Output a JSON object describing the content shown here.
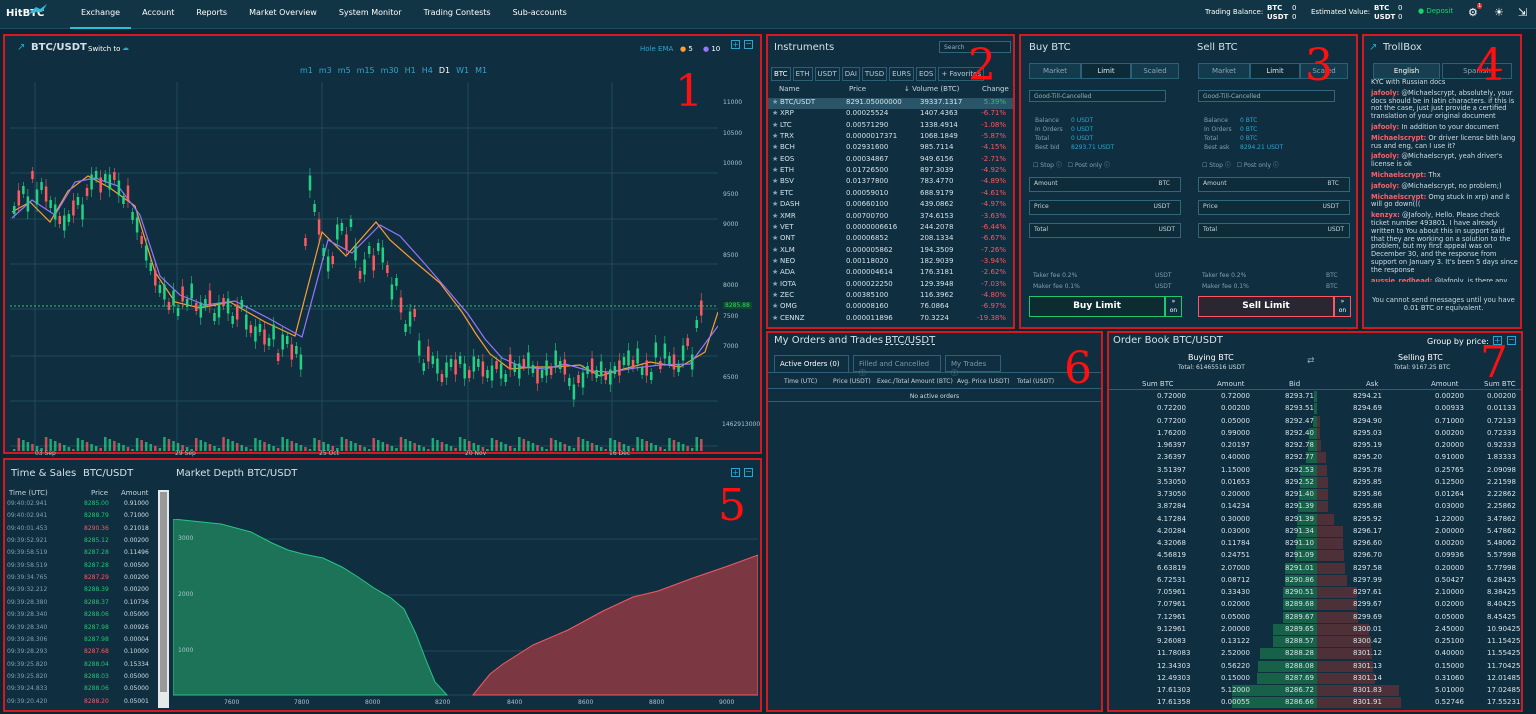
{
  "header": {
    "logo": "HitBTC",
    "nav": [
      "Exchange",
      "Account",
      "Reports",
      "Market Overview",
      "System Monitor",
      "Trading Contests",
      "Sub-accounts"
    ],
    "trading_balance_label": "Trading Balance:",
    "btc_label": "BTC",
    "usdt_label": "USDT",
    "btc_balance": "0",
    "usdt_balance": "0",
    "estimated_label": "Estimated Value:",
    "est_btc": "0",
    "est_usdt": "0",
    "deposit": "Deposit",
    "settings_badge": "1"
  },
  "chart": {
    "title": "BTC/USDT",
    "switch_label": "Switch to",
    "hole_ema": "Hole EMA",
    "ema1": "5",
    "ema2": "10",
    "timeframes": [
      "m1",
      "m3",
      "m5",
      "m15",
      "m30",
      "H1",
      "H4",
      "D1",
      "W1",
      "M1"
    ],
    "price_labels": [
      "11000",
      "10500",
      "10000",
      "9500",
      "9000",
      "8500",
      "8000",
      "7500",
      "7000",
      "6500"
    ],
    "last_price": "8285.88",
    "volume_label": "1462913000",
    "dates": [
      "03 Sep",
      "29 Sep",
      "25 Oct",
      "20 Nov",
      "16 Dec"
    ],
    "number": "1"
  },
  "instruments": {
    "title": "Instruments",
    "search": "Search",
    "tabs": [
      "BTC",
      "ETH",
      "USDT",
      "DAI",
      "TUSD",
      "EURS",
      "EOS",
      "+ Favorites"
    ],
    "headers": [
      "Name",
      "Price",
      "Volume (BTC)",
      "Change"
    ],
    "rows": [
      [
        "BTC/USDT",
        "8291.05000000",
        "39337.1317",
        "5.39%"
      ],
      [
        "XRP",
        "0.00025524",
        "1407.4363",
        "-6.71%"
      ],
      [
        "LTC",
        "0.00571290",
        "1338.4914",
        "-1.08%"
      ],
      [
        "TRX",
        "0.0000017371",
        "1068.1849",
        "-5.87%"
      ],
      [
        "BCH",
        "0.02931600",
        "985.7114",
        "-4.15%"
      ],
      [
        "EOS",
        "0.00034867",
        "949.6156",
        "-2.71%"
      ],
      [
        "ETH",
        "0.01726500",
        "897.3039",
        "-4.92%"
      ],
      [
        "BSV",
        "0.01377800",
        "783.4770",
        "-4.89%"
      ],
      [
        "ETC",
        "0.00059010",
        "688.9179",
        "-4.61%"
      ],
      [
        "DASH",
        "0.00660100",
        "439.0862",
        "-4.97%"
      ],
      [
        "XMR",
        "0.00700700",
        "374.6153",
        "-3.63%"
      ],
      [
        "VET",
        "0.0000006616",
        "244.2078",
        "-6.44%"
      ],
      [
        "ONT",
        "0.00006852",
        "208.1334",
        "-6.67%"
      ],
      [
        "XLM",
        "0.000005862",
        "194.3509",
        "-7.26%"
      ],
      [
        "NEO",
        "0.00118020",
        "182.9039",
        "-3.94%"
      ],
      [
        "ADA",
        "0.000004614",
        "176.3181",
        "-2.62%"
      ],
      [
        "IOTA",
        "0.000022250",
        "129.3948",
        "-7.03%"
      ],
      [
        "ZEC",
        "0.00385100",
        "116.3962",
        "-4.80%"
      ],
      [
        "OMG",
        "0.00008160",
        "76.0864",
        "-6.97%"
      ],
      [
        "CENNZ",
        "0.000011896",
        "70.3224",
        "-19.38%"
      ]
    ],
    "number": "2"
  },
  "trade": {
    "buy_title": "Buy BTC",
    "sell_title": "Sell BTC",
    "tabs": [
      "Market",
      "Limit",
      "Scaled"
    ],
    "tif": "Good-Till-Cancelled",
    "balance_label": "Balance",
    "in_orders_label": "In Orders",
    "total_label": "Total",
    "best_bid_label": "Best bid",
    "best_ask_label": "Best ask",
    "buy_balance": "0 USDT",
    "buy_orders": "0 USDT",
    "buy_total": "0 USDT",
    "best_bid": "8293.71 USDT",
    "sell_balance": "0 BTC",
    "sell_orders": "0 BTC",
    "sell_total": "0 BTC",
    "best_ask": "8294.21 USDT",
    "stop": "Stop",
    "post_only": "Post only",
    "amount": "Amount",
    "price": "Price",
    "total": "Total",
    "btc": "BTC",
    "usdt": "USDT",
    "taker_fee": "Taker fee 0.2%",
    "maker_fee": "Maker fee 0.1%",
    "buy_button": "Buy Limit",
    "sell_button": "Sell Limit",
    "on": "on",
    "number": "3"
  },
  "troll": {
    "title": "TrollBox",
    "tabs": [
      "English",
      "Spanish"
    ],
    "messages": [
      [
        "",
        "KYC with Russian docs"
      ],
      [
        "jafooly:",
        "@Michaelscrypt, absolutely, your docs should be in latin characters. if this is not the case, just just provide a certified translation of your original document"
      ],
      [
        "jafooly:",
        "In addition to your document"
      ],
      [
        "Michaelscrypt:",
        "Or driver license bith lang rus and eng, can I use it?"
      ],
      [
        "jafooly:",
        "@Michaelscrypt, yeah driver's license is ok"
      ],
      [
        "Michaelscrypt:",
        "Thx"
      ],
      [
        "jafooly:",
        "@Michaelscrypt, no problem;)"
      ],
      [
        "Michaelscrypt:",
        "Omg stuck in xrp) and it will go down((("
      ],
      [
        "kenzyx:",
        "@Jafooly, Hello. Please check ticket number 493801. I have already written to You about this in support said that they are working on a solution to the problem, but my first appeal was on December 30, and the response from support on January 3. It's been 5 days since the response"
      ],
      [
        "aussie_redhead:",
        "@Jafooly, is there any way to check trading history beyond 1 year ago? My orders and trades only goes back 1 year..."
      ]
    ],
    "notice": "You cannot send messages until you have 0.01 BTC or equivalent.",
    "number": "4"
  },
  "timesales": {
    "title": "Time & Sales",
    "pair": "BTC/USDT",
    "headers": [
      "Time (UTC)",
      "Price",
      "Amount"
    ],
    "rows": [
      [
        "09:40:02.941",
        "8285.00",
        "0.91000",
        "g"
      ],
      [
        "09:40:02.941",
        "8288.79",
        "0.71000",
        "g"
      ],
      [
        "09:40:01.453",
        "8290.36",
        "0.21018",
        "r"
      ],
      [
        "09:39:52.921",
        "8285.12",
        "0.00200",
        "g"
      ],
      [
        "09:39:58.519",
        "8287.28",
        "0.11496",
        "g"
      ],
      [
        "09:39:58.519",
        "8287.28",
        "0.00500",
        "g"
      ],
      [
        "09:39:34.765",
        "8287.29",
        "0.00200",
        "r"
      ],
      [
        "09:39:32.212",
        "8288.39",
        "0.00200",
        "g"
      ],
      [
        "09:39:28.380",
        "8288.37",
        "0.10736",
        "g"
      ],
      [
        "09:39:28.340",
        "8288.06",
        "0.05000",
        "g"
      ],
      [
        "09:39:28.340",
        "8287.98",
        "0.00926",
        "g"
      ],
      [
        "09:39:28.306",
        "8287.98",
        "0.00004",
        "g"
      ],
      [
        "09:39:28.293",
        "8287.68",
        "0.10000",
        "r"
      ],
      [
        "09:39:25.820",
        "8288.04",
        "0.15334",
        "g"
      ],
      [
        "09:39:25.820",
        "8288.03",
        "0.05000",
        "g"
      ],
      [
        "09:39:24.833",
        "8288.06",
        "0.05000",
        "g"
      ],
      [
        "09:39:20.420",
        "8288.20",
        "0.05001",
        "r"
      ]
    ],
    "number": "5"
  },
  "depth": {
    "title": "Market Depth BTC/USDT",
    "y_labels": [
      "3000",
      "2000",
      "1000"
    ],
    "x_labels": [
      "7600",
      "7800",
      "8000",
      "8200",
      "8400",
      "8600",
      "8800",
      "9000"
    ]
  },
  "orders": {
    "title": "My Orders and Trades",
    "pair": "BTC/USDT",
    "tabs": [
      "Active Orders (0)",
      "Filled and Cancelled",
      "My Trades"
    ],
    "headers": [
      "Time (UTC)",
      "Price (USDT)",
      "Exec./Total Amount (BTC)",
      "Avg. Price (USDT)",
      "Total (USDT)"
    ],
    "empty": "No active orders",
    "number": "6"
  },
  "orderbook": {
    "title": "Order Book BTC/USDT",
    "group": "Group by price:",
    "buying": "Buying BTC",
    "selling": "Selling BTC",
    "buy_total": "Total: 61465516 USDT",
    "sell_total": "Total: 9167.25 BTC",
    "headers": [
      "Sum BTC",
      "Amount",
      "Bid",
      "Ask",
      "Amount",
      "Sum BTC"
    ],
    "rows": [
      [
        "0.72000",
        "0.72000",
        "8293.71",
        "8294.21",
        "0.00200",
        "0.00200"
      ],
      [
        "0.72200",
        "0.00200",
        "8293.51",
        "8294.69",
        "0.00933",
        "0.01133"
      ],
      [
        "0.77200",
        "0.05000",
        "8292.47",
        "8294.90",
        "0.71000",
        "0.72133"
      ],
      [
        "1.76200",
        "0.99000",
        "8292.40",
        "8295.03",
        "0.00200",
        "0.72333"
      ],
      [
        "1.96397",
        "0.20197",
        "8292.78",
        "8295.19",
        "0.20000",
        "0.92333"
      ],
      [
        "2.36397",
        "0.40000",
        "8292.77",
        "8295.20",
        "0.91000",
        "1.83333"
      ],
      [
        "3.51397",
        "1.15000",
        "8292.53",
        "8295.78",
        "0.25765",
        "2.09098"
      ],
      [
        "3.53050",
        "0.01653",
        "8292.52",
        "8295.85",
        "0.12500",
        "2.21598"
      ],
      [
        "3.73050",
        "0.20000",
        "8291.40",
        "8295.86",
        "0.01264",
        "2.22862"
      ],
      [
        "3.87284",
        "0.14234",
        "8291.39",
        "8295.88",
        "0.03000",
        "2.25862"
      ],
      [
        "4.17284",
        "0.30000",
        "8291.39",
        "8295.92",
        "1.22000",
        "3.47862"
      ],
      [
        "4.20284",
        "0.03000",
        "8291.34",
        "8296.17",
        "2.00000",
        "5.47862"
      ],
      [
        "4.32068",
        "0.11784",
        "8291.10",
        "8296.60",
        "0.00200",
        "5.48062"
      ],
      [
        "4.56819",
        "0.24751",
        "8291.09",
        "8296.70",
        "0.09936",
        "5.57998"
      ],
      [
        "6.63819",
        "2.07000",
        "8291.01",
        "8297.58",
        "0.20000",
        "5.77998"
      ],
      [
        "6.72531",
        "0.08712",
        "8290.86",
        "8297.99",
        "0.50427",
        "6.28425"
      ],
      [
        "7.05961",
        "0.33430",
        "8290.51",
        "8297.61",
        "2.10000",
        "8.38425"
      ],
      [
        "7.07961",
        "0.02000",
        "8289.68",
        "8299.67",
        "0.02000",
        "8.40425"
      ],
      [
        "7.12961",
        "0.05000",
        "8289.67",
        "8299.69",
        "0.05000",
        "8.45425"
      ],
      [
        "9.12961",
        "2.00000",
        "8289.65",
        "8300.01",
        "2.45000",
        "10.90425"
      ],
      [
        "9.26083",
        "0.13122",
        "8288.57",
        "8300.42",
        "0.25100",
        "11.15425"
      ],
      [
        "11.78083",
        "2.52000",
        "8288.28",
        "8301.12",
        "0.40000",
        "11.55425"
      ],
      [
        "12.34303",
        "0.56220",
        "8288.08",
        "8301.13",
        "0.15000",
        "11.70425"
      ],
      [
        "12.49303",
        "0.15000",
        "8287.69",
        "8301.14",
        "0.31060",
        "12.01485"
      ],
      [
        "17.61303",
        "5.12000",
        "8286.72",
        "8301.83",
        "5.01000",
        "17.02485"
      ],
      [
        "17.61358",
        "0.00055",
        "8286.66",
        "8301.91",
        "0.52746",
        "17.55231"
      ]
    ],
    "number": "7"
  }
}
